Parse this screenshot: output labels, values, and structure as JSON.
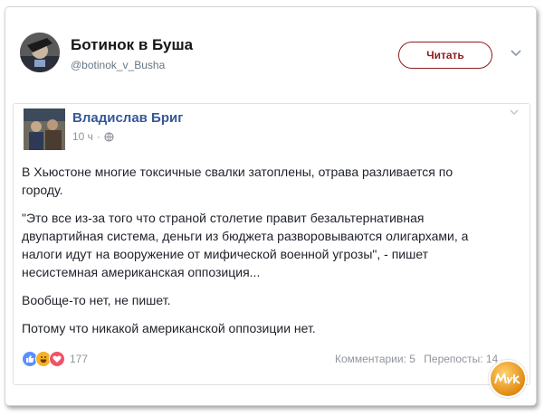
{
  "header": {
    "name": "Ботинок в Буша",
    "handle": "@botinok_v_Busha",
    "follow_label": "Читать"
  },
  "post": {
    "author": "Владислав Бриг",
    "time": "10 ч",
    "separator": "·",
    "paragraphs": [
      "В Хьюстоне многие токсичные свалки затоплены, отрава разливается по городу.",
      "\"Это все из-за того что страной столетие правит безальтернативная двупартийная система, деньги из бюджета разворовываются олигархами, а налоги идут на вооружение от мифической военной угрозы\", - пишет несистемная американская оппозиция...",
      "Вообще-то нет, не пишет.",
      "Потому что никакой американской оппозиции нет."
    ],
    "reactions": {
      "count": "177",
      "icons": [
        "like-icon",
        "haha-icon",
        "love-icon"
      ]
    },
    "comments_label": "Комментарии: 5",
    "shares_label": "Перепосты: 14"
  },
  "watermark": {
    "text": "Мика"
  },
  "colors": {
    "author_link": "#365899",
    "follow_accent": "#8c1c1c",
    "meta_gray": "#90949c"
  }
}
